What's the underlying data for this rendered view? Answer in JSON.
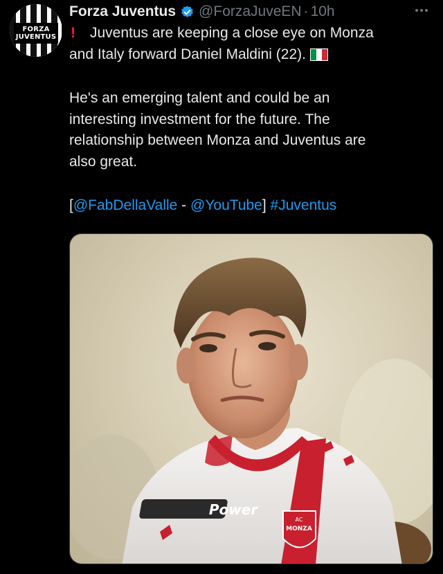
{
  "account": {
    "avatar_lines": [
      "FORZA",
      "JUVENTUS"
    ],
    "name": "Forza Juventus",
    "handle": "@ForzaJuveEN",
    "separator": "·",
    "time": "10h"
  },
  "tweet": {
    "lines": [
      "Juventus are keeping a close eye on Monza",
      "and Italy forward Daniel Maldini (22).",
      "He's an emerging talent and could be an",
      "interesting investment for the future. The",
      "relationship between Monza and Juventus are",
      "also great."
    ],
    "alert_glyph": "!",
    "source_open": "[",
    "source_1": "@FabDellaValle",
    "source_dash": " - ",
    "source_2": "@YouTube",
    "source_close": "]",
    "hashtag": "#Juventus"
  },
  "media": {
    "jersey_sponsor": "Power",
    "badge_lines": [
      "AC",
      "MONZA"
    ]
  },
  "colors": {
    "link": "#1d9bf0",
    "verified": "#1d9bf0",
    "alert": "#f4212e",
    "secondary_text": "#71767b"
  },
  "icons": [
    "verified-badge-icon",
    "more-options-icon",
    "exclamation-icon",
    "italy-flag-icon"
  ]
}
